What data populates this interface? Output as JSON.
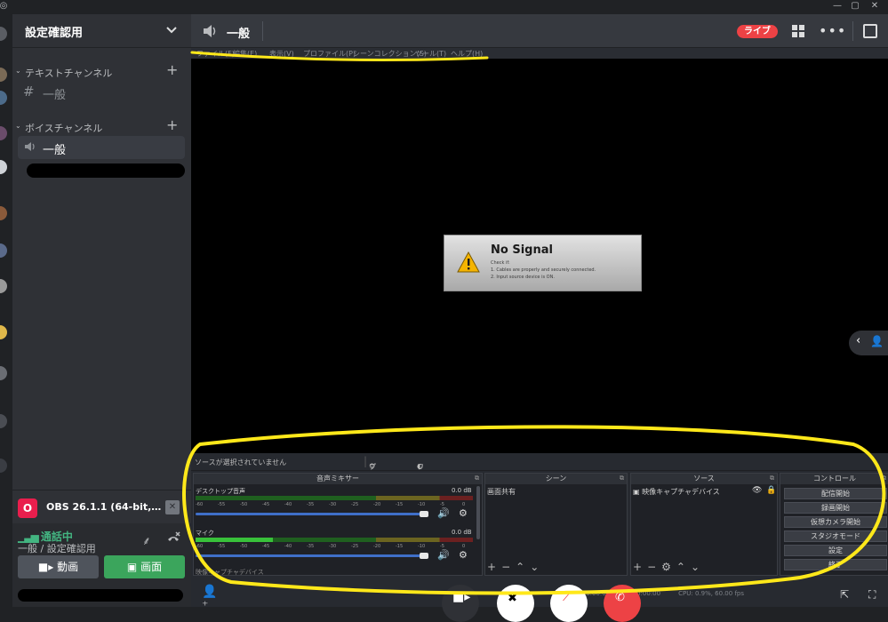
{
  "server": {
    "name": "設定確認用"
  },
  "categories": {
    "text": "テキストチャンネル",
    "voice": "ボイスチャンネル"
  },
  "channels": {
    "text_general": "一般",
    "voice_general": "一般"
  },
  "stream_preview": {
    "title": "OBS 26.1.1 (64-bit, win..."
  },
  "voice_status": {
    "title": "通話中",
    "subtitle": "一般 / 設定確認用",
    "video_label": "動画",
    "screen_label": "画面"
  },
  "header": {
    "channel_name": "一般",
    "live_label": "ライブ"
  },
  "obs": {
    "menu": [
      "ファイル(F)",
      "編集(E)",
      "表示(V)",
      "プロファイル(P)",
      "シーンコレクション(S)",
      "ツール(T)",
      "ヘルプ(H)"
    ],
    "no_signal": {
      "title": "No Signal",
      "check": "Check if:",
      "line1": "1. Cables are properly and securely connected.",
      "line2": "2. Input source device is ON."
    },
    "no_source": "ソースが選択されていません",
    "properties": "プロパティ",
    "filter": "フィルタ",
    "mixer": {
      "title": "音声ミキサー",
      "desktop": "デスクトップ音声",
      "desktop_db": "0.0 dB",
      "mic": "マイク",
      "mic_db": "0.0 dB",
      "third": "映像キャプチャデバイス",
      "scale": [
        "-60",
        "-55",
        "-50",
        "-45",
        "-40",
        "-35",
        "-30",
        "-25",
        "-20",
        "-15",
        "-10",
        "-5",
        "0"
      ]
    },
    "scenes": {
      "title": "シーン",
      "item": "画面共有"
    },
    "sources": {
      "title": "ソース",
      "item": "映像キャプチャデバイス"
    },
    "controls": {
      "title": "コントロール",
      "buttons": [
        "配信開始",
        "録画開始",
        "仮想カメラ開始",
        "スタジオモード",
        "設定",
        "終了"
      ]
    },
    "status": {
      "live": "LIVE: 00:00:00",
      "rec": "REC: 00:00:00",
      "cpu": "CPU: 0.9%, 60.00 fps"
    }
  },
  "colors": {
    "live_red": "#ed4245",
    "voice_green": "#43b581",
    "highlight_yellow": "#ffe81a",
    "obs_logo": "#e91e4d"
  },
  "meters": {
    "desktop_level": 0.0,
    "mic_level": 0.28
  }
}
